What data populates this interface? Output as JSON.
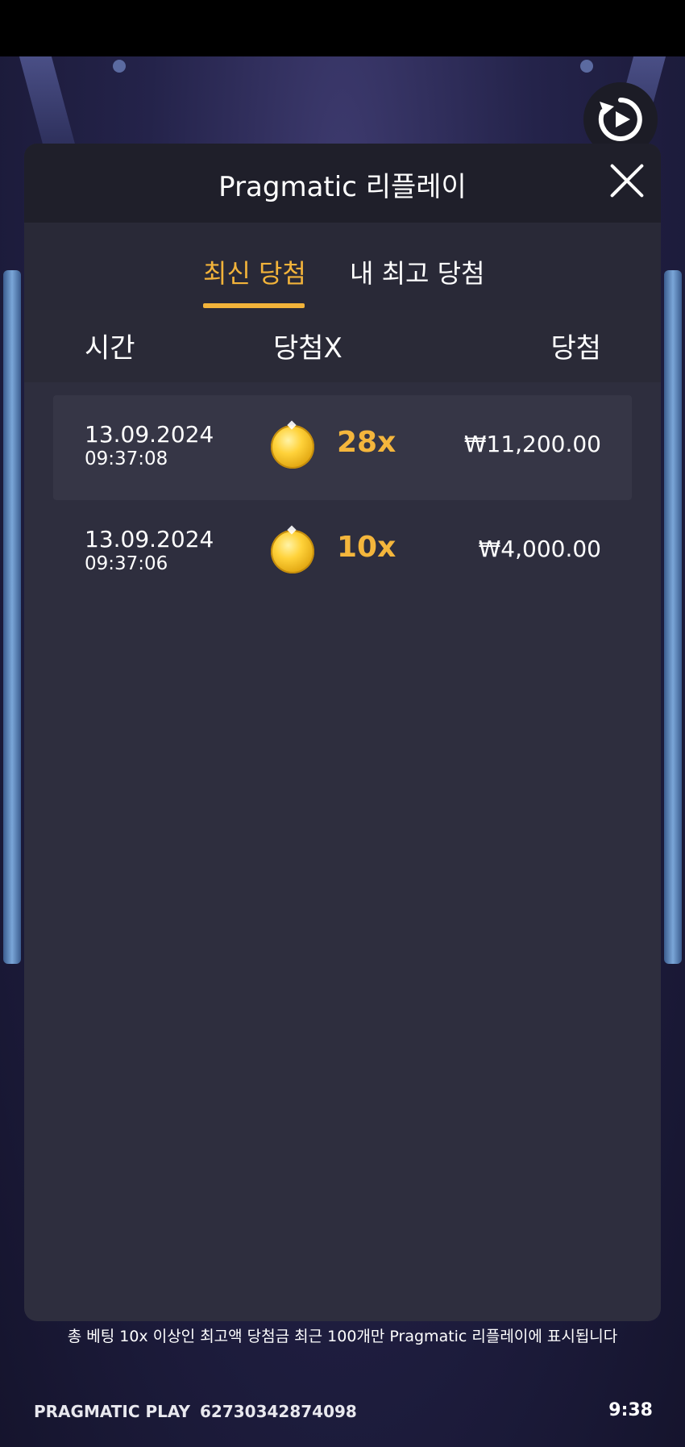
{
  "replay_button_icon": "replay-icon",
  "dialog": {
    "title": "Pragmatic 리플레이",
    "close_icon": "close-icon"
  },
  "tabs": [
    {
      "label": "최신 당첨",
      "active": true
    },
    {
      "label": "내 최고 당첨",
      "active": false
    }
  ],
  "columns": {
    "time": "시간",
    "multiplier": "당첨X",
    "win": "당첨"
  },
  "rows": [
    {
      "date": "13.09.2024",
      "time": "09:37:08",
      "icon": "coin-icon",
      "multiplier": "28x",
      "amount": "₩11,200.00"
    },
    {
      "date": "13.09.2024",
      "time": "09:37:06",
      "icon": "coin-icon",
      "multiplier": "10x",
      "amount": "₩4,000.00"
    }
  ],
  "footer": {
    "notice": "총 베팅 10x 이상인 최고액 당첨금 최근 100개만 Pragmatic 리플레이에 표시됩니다",
    "provider": "PRAGMATIC PLAY",
    "round_id": "62730342874098",
    "clock": "9:38"
  },
  "colors": {
    "accent": "#f2b33a",
    "panel": "#2e2e3e",
    "header": "#1f1f2a"
  }
}
